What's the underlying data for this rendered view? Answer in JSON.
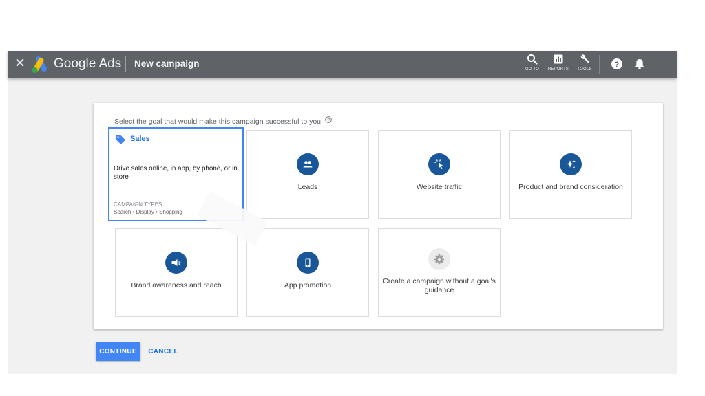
{
  "app": {
    "brand": "Google Ads",
    "page_title": "New campaign"
  },
  "toolbar": {
    "goto_label": "GO TO",
    "reports_label": "REPORTS",
    "tools_label": "TOOLS"
  },
  "goal_selection": {
    "prompt": "Select the goal that would make this campaign successful to you",
    "selected": "Sales",
    "sales": {
      "title": "Sales",
      "description": "Drive sales online, in app, by phone, or in store",
      "campaign_types_heading": "CAMPAIGN TYPES",
      "campaign_types": "Search • Display • Shopping"
    },
    "goals": [
      {
        "label": "Leads",
        "icon": "people-icon"
      },
      {
        "label": "Website traffic",
        "icon": "cursor-click-icon"
      },
      {
        "label": "Product and brand consideration",
        "icon": "sparkle-icon"
      },
      {
        "label": "Brand awareness and reach",
        "icon": "megaphone-icon"
      },
      {
        "label": "App promotion",
        "icon": "phone-icon"
      },
      {
        "label": "Create a campaign without a goal's guidance",
        "icon": "gear-icon"
      }
    ]
  },
  "actions": {
    "continue_label": "CONTINUE",
    "cancel_label": "CANCEL"
  },
  "colors": {
    "header_bg": "#5f6368",
    "accent": "#4285f4",
    "icon_circle": "#1a5799"
  }
}
